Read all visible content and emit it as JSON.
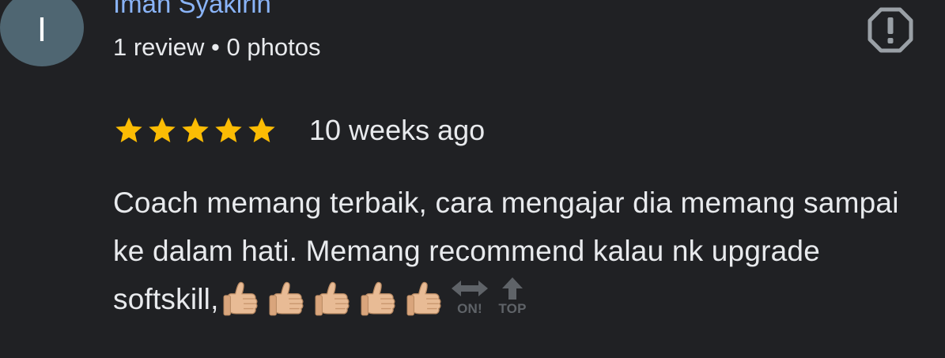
{
  "reviewer": {
    "initial": "I",
    "name": "Iman Syakirin",
    "meta": "1 review • 0 photos"
  },
  "review": {
    "rating": 5,
    "max_rating": 5,
    "date": "10 weeks ago",
    "text": "Coach memang terbaik, cara mengajar dia memang sampai ke dalam hati. Memang recommend kalau nk upgrade softskill,",
    "emoji": [
      "thumbs-up",
      "thumbs-up",
      "thumbs-up",
      "thumbs-up",
      "thumbs-up",
      "on-arrow",
      "top-arrow"
    ],
    "emoji_labels": {
      "on": "ON!",
      "top": "TOP"
    }
  },
  "colors": {
    "background": "#202124",
    "name": "#8ab4f8",
    "star": "#fbbc04",
    "text": "#e8eaed",
    "avatar": "#4f6672",
    "report_icon": "#9aa0a6"
  },
  "icons": {
    "report": "report-icon",
    "star": "star-icon"
  }
}
